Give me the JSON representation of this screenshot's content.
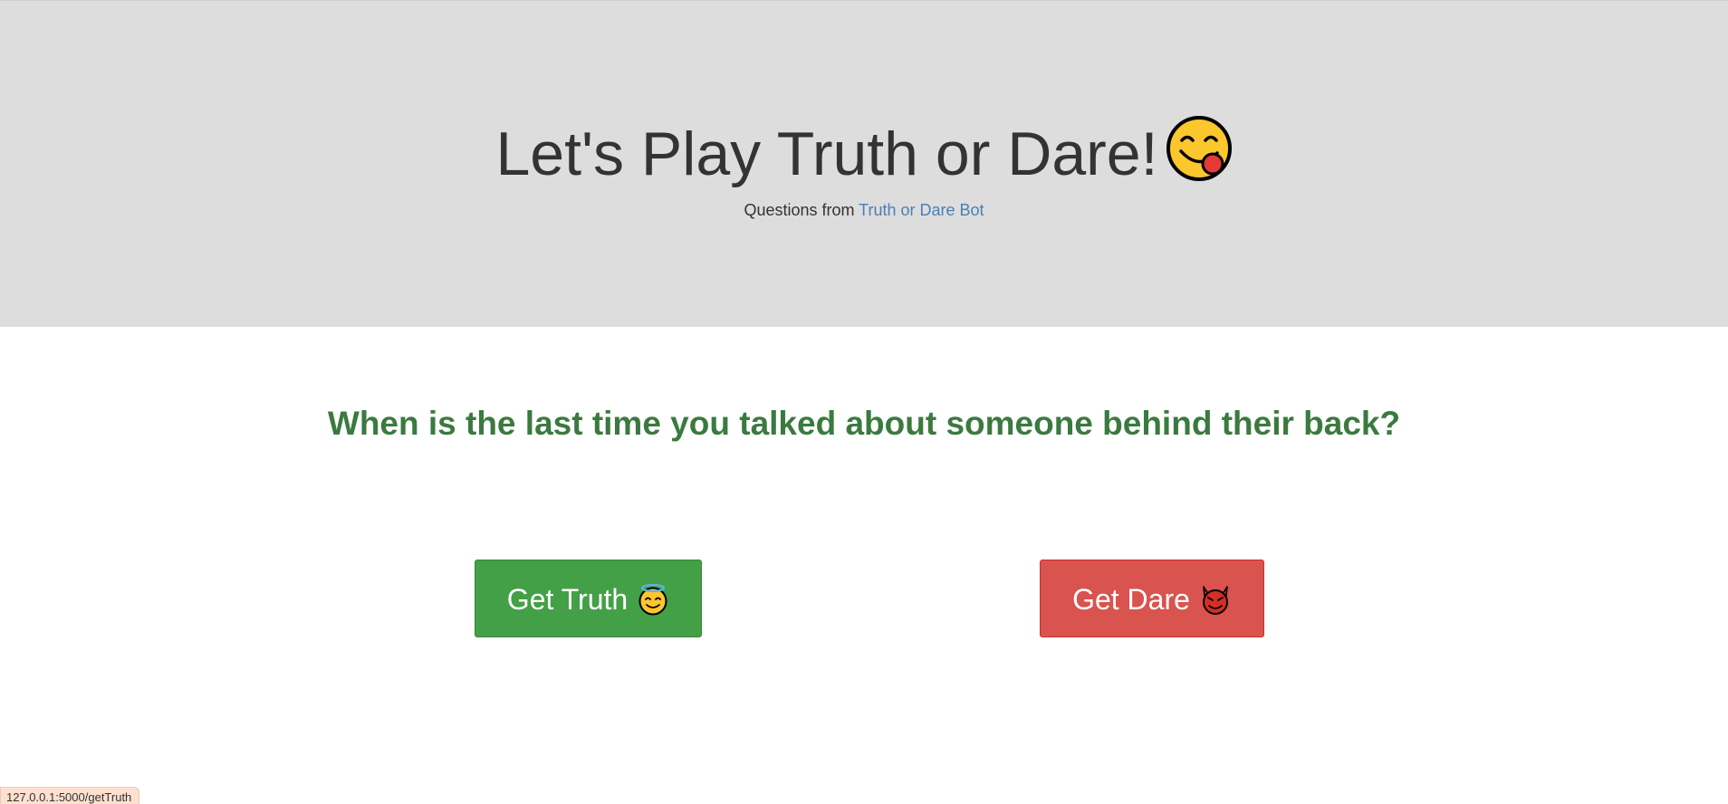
{
  "header": {
    "title": "Let's Play Truth or Dare!",
    "title_icon": "face-savoring-food-emoji",
    "subtitle_prefix": "Questions from",
    "subtitle_link": "Truth or Dare Bot"
  },
  "main": {
    "question": "When is the last time you talked about someone behind their back?",
    "truth_button": {
      "label": "Get Truth",
      "icon": "smiling-face-with-halo-emoji"
    },
    "dare_button": {
      "label": "Get Dare",
      "icon": "smiling-face-with-horns-emoji"
    }
  },
  "status_bar": {
    "url": "127.0.0.1:5000/getTruth"
  },
  "colors": {
    "header_bg": "#dddddd",
    "question": "#3b7a3f",
    "link": "#4a7fb5",
    "truth_button": "#43a047",
    "dare_button": "#d9534f",
    "status_bar_bg": "#fde0d0"
  }
}
